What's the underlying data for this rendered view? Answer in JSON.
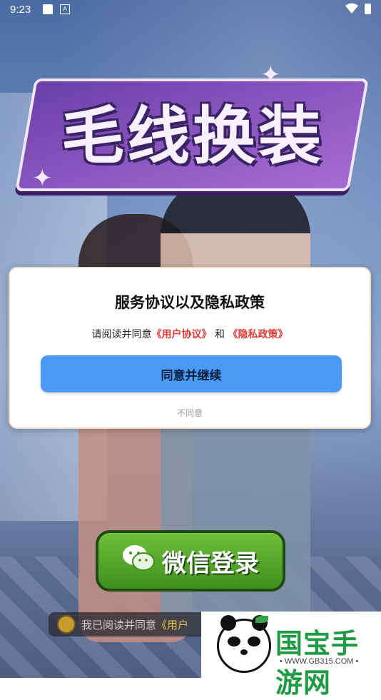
{
  "status_bar": {
    "time": "9:23",
    "notif_glyph": "A"
  },
  "game": {
    "title": "毛线换装"
  },
  "dialog": {
    "title": "服务协议以及隐私政策",
    "desc_prefix": "请阅读并同意",
    "link_user_agreement": "《用户协议》",
    "desc_and": "和",
    "link_privacy": "《隐私政策》",
    "agree_button": "同意并继续",
    "disagree_button": "不同意"
  },
  "login": {
    "wechat_label": "微信登录"
  },
  "agreement_strip": {
    "text": "我已阅读并同意",
    "link": "《用户"
  },
  "watermark": {
    "name": "国宝手游网",
    "url": "• WWW.GB315.COM •"
  },
  "colors": {
    "link_red": "#e53935",
    "button_blue": "#4a9af5",
    "wechat_green": "#4fa42a",
    "watermark_green": "#1e9c43"
  }
}
